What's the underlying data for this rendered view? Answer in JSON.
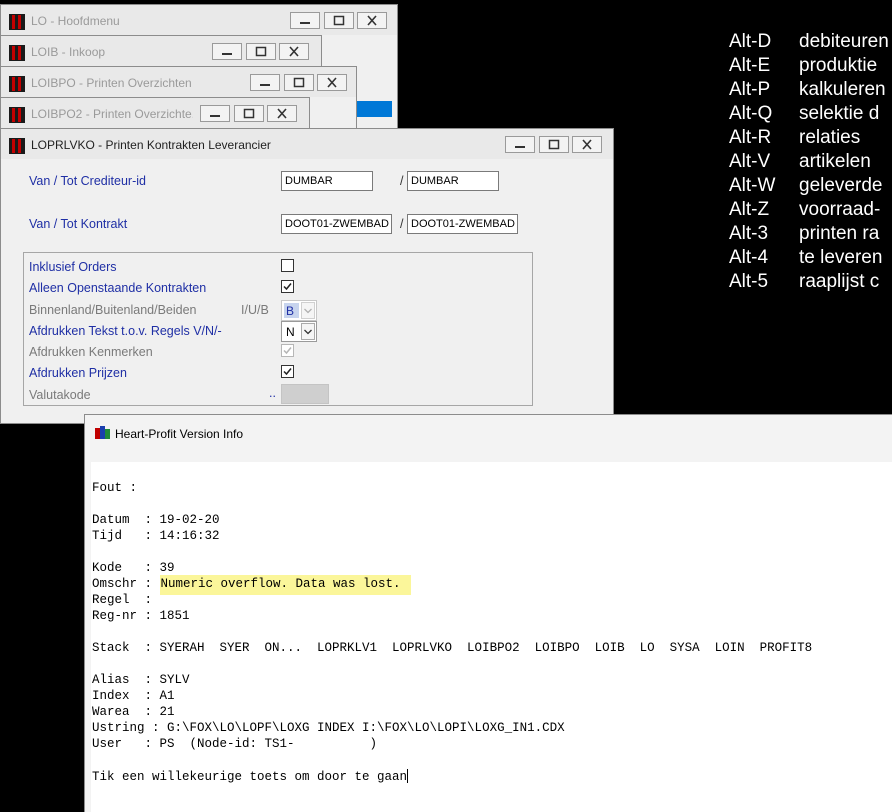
{
  "windows": {
    "hoofdmenu": {
      "title": "LO - Hoofdmenu"
    },
    "inkoop": {
      "title": "LOIB - Inkoop"
    },
    "printen_overzichten": {
      "title": "LOIBPO - Printen Overzichten"
    },
    "printen_overzichten2": {
      "title": "LOIBPO2 - Printen Overzichte..."
    },
    "printen_kontrakten": {
      "title": "LOPRLVKO - Printen Kontrakten Leverancier",
      "crediteur": {
        "label": "Van / Tot Crediteur-id",
        "from": "DUMBAR",
        "sep": "/",
        "to": "DUMBAR"
      },
      "kontrakt": {
        "label": "Van / Tot Kontrakt",
        "from": "DOOT01-ZWEMBAD",
        "sep": "/",
        "to": "DOOT01-ZWEMBAD"
      },
      "options": {
        "inklusief_orders": {
          "label": "Inklusief Orders",
          "checked": false
        },
        "alleen_openstaande": {
          "label": "Alleen Openstaande Kontrakten",
          "checked": true
        },
        "binnenland": {
          "label": "Binnenland/Buitenland/Beiden",
          "hint": "I/U/B",
          "value": "B",
          "enabled": false
        },
        "afdrukken_tekst": {
          "label": "Afdrukken Tekst t.o.v. Regels V/N/-",
          "value": "N"
        },
        "afdrukken_kenmerken": {
          "label": "Afdrukken Kenmerken",
          "checked": true,
          "enabled": false
        },
        "afdrukken_prijzen": {
          "label": "Afdrukken Prijzen",
          "checked": true
        },
        "valutakode": {
          "label": "Valutakode",
          "dots": "..",
          "value": "",
          "enabled": false
        }
      }
    },
    "version_info": {
      "title": "Heart-Profit Version Info"
    }
  },
  "alt_shortcuts": [
    {
      "key": "Alt-D",
      "desc": "debiteuren"
    },
    {
      "key": "Alt-E",
      "desc": "produktie"
    },
    {
      "key": "Alt-P",
      "desc": "kalkuleren"
    },
    {
      "key": "Alt-Q",
      "desc": "selektie d"
    },
    {
      "key": "Alt-R",
      "desc": "relaties"
    },
    {
      "key": "Alt-V",
      "desc": "artikelen"
    },
    {
      "key": "Alt-W",
      "desc": "geleverde"
    },
    {
      "key": "Alt-Z",
      "desc": "voorraad-"
    },
    {
      "key": "Alt-3",
      "desc": "printen ra"
    },
    {
      "key": "Alt-4",
      "desc": "te leveren"
    },
    {
      "key": "Alt-5",
      "desc": "raaplijst c"
    }
  ],
  "error_console": {
    "fout": "Fout :",
    "datum": "Datum  : 19-02-20",
    "tijd": "Tijd   : 14:16:32",
    "kode": "Kode   : 39",
    "omschr_label": "Omschr : ",
    "omschr_value": "Numeric overflow. Data was lost.",
    "regel": "Regel  :",
    "regnr": "Reg-nr : 1851",
    "stack": "Stack  : SYERAH  SYER  ON...  LOPRKLV1  LOPRLVKO  LOIBPO2  LOIBPO  LOIB  LO  SYSA  LOIN  PROFIT8",
    "alias": "Alias  : SYLV",
    "index": "Index  : A1",
    "warea": "Warea  : 21",
    "ustring": "Ustring : G:\\FOX\\LO\\LOPF\\LOXG INDEX I:\\FOX\\LO\\LOPI\\LOXG_IN1.CDX",
    "user": "User   : PS  (Node-id: TS1-          )",
    "prompt": "Tik een willekeurige toets om door te gaan"
  },
  "colors": {
    "label_blue": "#1f2fa5",
    "highlight": "#fbf69a",
    "combo_disabled": "#c7d4ee"
  }
}
